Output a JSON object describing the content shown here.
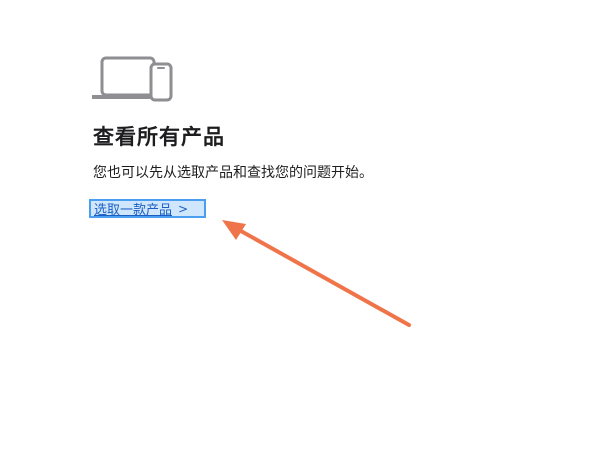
{
  "hero": {
    "icon": "laptop-phone-icon"
  },
  "title": "查看所有产品",
  "subtitle": "您也可以先从选取产品和查找您的问题开始。",
  "choose_link": {
    "label": "选取一款产品",
    "chevron": ">"
  },
  "annotation": {
    "icon": "pointer-arrow",
    "color": "#f0744a"
  },
  "colors": {
    "link": "#1a5ec4",
    "highlight_border": "#4a9ef0",
    "highlight_fill": "#cfe6fc",
    "icon_gray": "#8e8e93"
  }
}
